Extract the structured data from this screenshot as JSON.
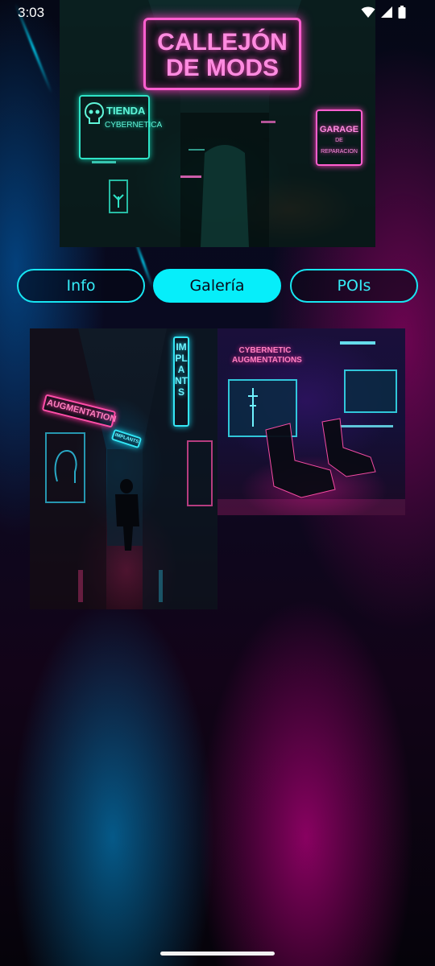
{
  "status_bar": {
    "time": "3:03"
  },
  "hero": {
    "sign_main_line1": "CALLEJÓN",
    "sign_main_line2": "DE MODS",
    "sign_left_line1": "TIENDA",
    "sign_left_line2": "CYBERNETICA",
    "sign_right_line1": "GARAGE",
    "sign_right_line2": "DE REPARACION"
  },
  "tabs": [
    {
      "label": "Info",
      "active": false
    },
    {
      "label": "Galería",
      "active": true
    },
    {
      "label": "POIs",
      "active": false
    }
  ],
  "gallery": {
    "image1": {
      "sign_augmentation": "AUGMENTATION",
      "sign_implants_vertical": "IMPLANTS",
      "sign_implants_small": "IMPLANTS"
    },
    "image2": {
      "sign_line1": "CYBERNETIC",
      "sign_line2": "AUGMENTATIONS"
    }
  },
  "colors": {
    "accent": "#06eefa",
    "neon_pink": "#ff4fa8",
    "neon_cyan": "#35e6f5"
  }
}
